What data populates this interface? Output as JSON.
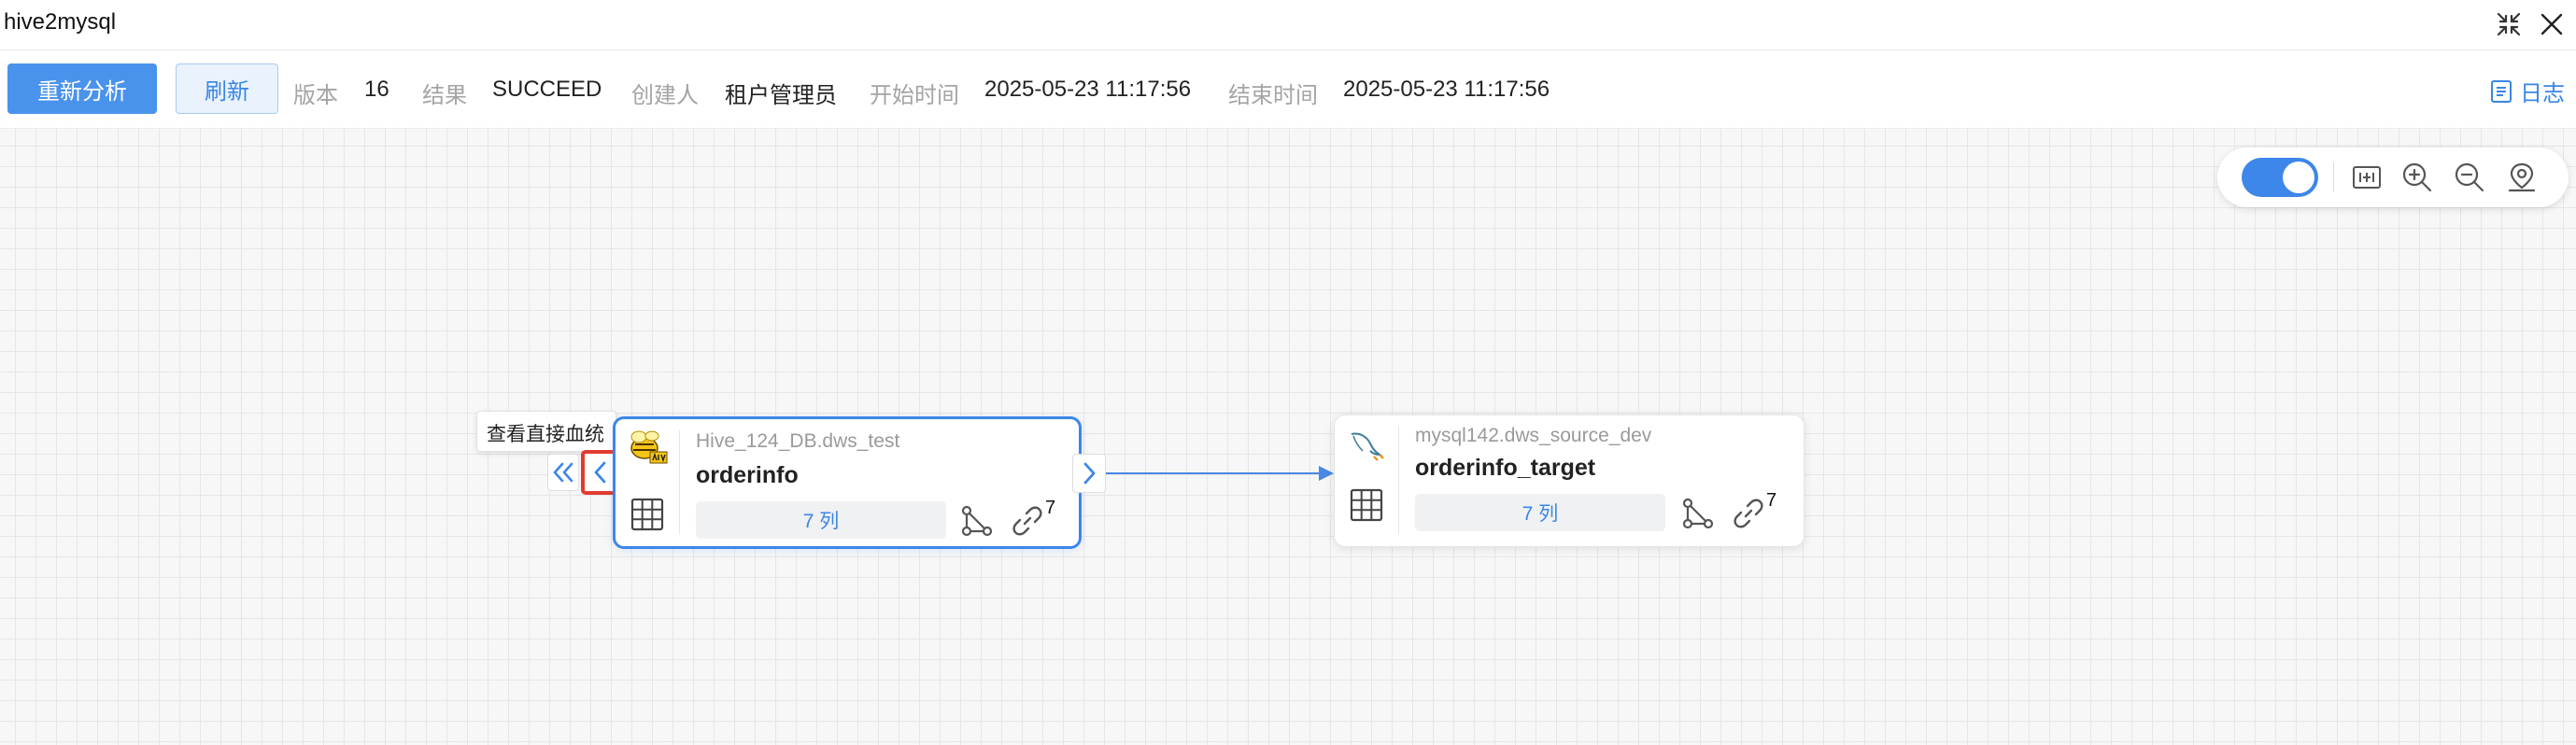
{
  "window": {
    "title": "hive2mysql"
  },
  "toolbar": {
    "reanalyze_label": "重新分析",
    "refresh_label": "刷新",
    "version_label": "版本",
    "version_value": "16",
    "result_label": "结果",
    "result_value": "SUCCEED",
    "creator_label": "创建人",
    "creator_value": "租户管理员",
    "start_label": "开始时间",
    "start_value": "2025-05-23 11:17:56",
    "end_label": "结束时间",
    "end_value": "2025-05-23 11:17:56",
    "log_label": "日志"
  },
  "tooltip": {
    "text": "查看直接血统"
  },
  "nodes": [
    {
      "db": "Hive_124_DB.dws_test",
      "table": "orderinfo",
      "columns_label": "7 列",
      "relation_count": "7",
      "source_icon": "hive-bee-icon"
    },
    {
      "db": "mysql142.dws_source_dev",
      "table": "orderinfo_target",
      "columns_label": "7 列",
      "relation_count": "7",
      "source_icon": "mysql-dolphin-icon"
    }
  ],
  "colors": {
    "accent": "#3d86ea",
    "highlight": "#e23b2e",
    "primary_button": "#4a93ec"
  }
}
